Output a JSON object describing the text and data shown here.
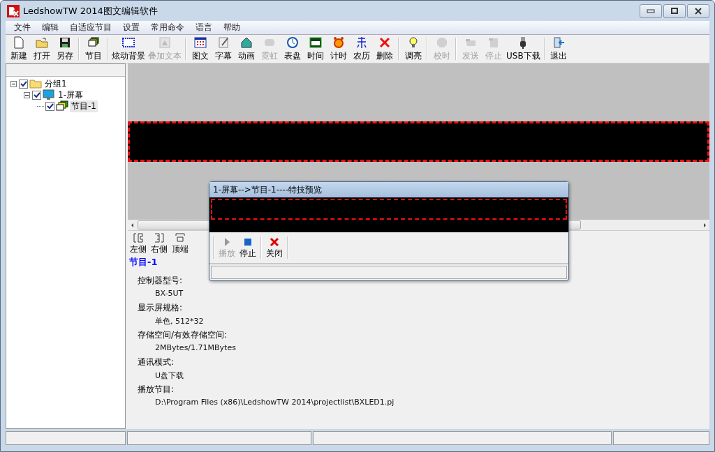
{
  "window": {
    "title": "LedshowTW 2014图文编辑软件"
  },
  "menu": [
    "文件",
    "编辑",
    "自适应节目",
    "设置",
    "常用命令",
    "语言",
    "帮助"
  ],
  "toolbar": [
    [
      {
        "label": "新建",
        "disabled": false
      },
      {
        "label": "打开",
        "disabled": false
      },
      {
        "label": "另存",
        "disabled": false
      }
    ],
    [
      {
        "label": "节目",
        "disabled": false
      }
    ],
    [
      {
        "label": "炫动背景",
        "disabled": false
      },
      {
        "label": "叠加文本",
        "disabled": true
      }
    ],
    [
      {
        "label": "图文",
        "disabled": false
      },
      {
        "label": "字幕",
        "disabled": false
      },
      {
        "label": "动画",
        "disabled": false
      },
      {
        "label": "霓虹",
        "disabled": true
      },
      {
        "label": "表盘",
        "disabled": false
      },
      {
        "label": "时间",
        "disabled": false
      },
      {
        "label": "计时",
        "disabled": false
      },
      {
        "label": "农历",
        "disabled": false
      },
      {
        "label": "删除",
        "disabled": false
      }
    ],
    [
      {
        "label": "调亮",
        "disabled": false
      }
    ],
    [
      {
        "label": "校时",
        "disabled": true
      }
    ],
    [
      {
        "label": "发送",
        "disabled": true
      },
      {
        "label": "停止",
        "disabled": true
      },
      {
        "label": "USB下载",
        "disabled": false
      }
    ],
    [
      {
        "label": "退出",
        "disabled": false
      }
    ]
  ],
  "tree": [
    {
      "label": "分组1",
      "checked": true,
      "expanded": true,
      "selected": false,
      "children": [
        {
          "label": "1-屏幕",
          "checked": true,
          "expanded": true,
          "selected": false,
          "children": [
            {
              "label": "节目-1",
              "checked": true,
              "selected": true
            }
          ]
        }
      ]
    }
  ],
  "align_toolbar": [
    "左侧",
    "右侧",
    "顶端"
  ],
  "info": {
    "title": "节目-1",
    "fields": [
      {
        "label": "控制器型号:",
        "value": "BX-5UT"
      },
      {
        "label": "显示屏规格:",
        "value": "单色, 512*32"
      },
      {
        "label": "存储空间/有效存储空间:",
        "value": "2MBytes/1.71MBytes"
      },
      {
        "label": "通讯模式:",
        "value": "U盘下载"
      },
      {
        "label": "播放节目:",
        "value": "D:\\Program Files (x86)\\LedshowTW 2014\\projectlist\\BXLED1.pj"
      }
    ]
  },
  "dialog": {
    "title": "1-屏幕-->节目-1----特技预览",
    "buttons": [
      {
        "label": "播放",
        "disabled": true
      },
      {
        "label": "停止",
        "disabled": false
      },
      {
        "label": "关闭",
        "disabled": false
      }
    ]
  }
}
